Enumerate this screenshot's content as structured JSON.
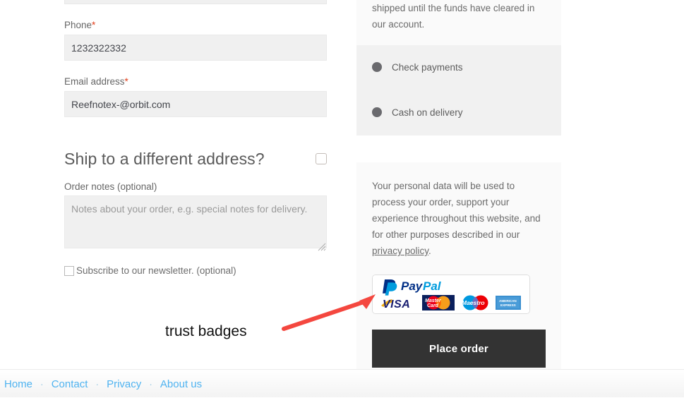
{
  "billing": {
    "phone": {
      "label": "Phone",
      "required_mark": "*",
      "value": "1232322332"
    },
    "email": {
      "label": "Email address",
      "required_mark": "*",
      "value": "Reefnotex-@orbit.com"
    }
  },
  "shipping": {
    "title": "Ship to a different address?",
    "notes_label": "Order notes (optional)",
    "notes_value": "",
    "notes_placeholder": "Notes about your order, e.g. special notes for delivery.",
    "newsletter_label": "Subscribe to our newsletter. (optional)"
  },
  "order_review": {
    "bank_note": "shipped until the funds have cleared in our account.",
    "payment_methods": [
      {
        "label": "Check payments"
      },
      {
        "label": "Cash on delivery"
      }
    ],
    "privacy_text_before": "Your personal data will be used to process your order, support your experience throughout this website, and for other purposes described in our ",
    "privacy_link": "privacy policy",
    "privacy_text_after": ".",
    "badge": {
      "paypal_pay": "Pay",
      "paypal_pal": "Pal",
      "visa": "VISA",
      "mastercard_top": "Master",
      "mastercard_bottom": "Card",
      "maestro": "Maestro",
      "amex_top": "AMERICAN",
      "amex_bottom": "EXPRESS"
    },
    "place_order_label": "Place order"
  },
  "annotation": {
    "label": "trust badges",
    "arrow_color": "#f4473f"
  },
  "footer": {
    "separator": "·",
    "links": [
      {
        "label": "Home"
      },
      {
        "label": "Contact"
      },
      {
        "label": "Privacy"
      },
      {
        "label": "About us"
      }
    ]
  },
  "colors": {
    "accent_link": "#4fb3f0",
    "required": "#e2401c",
    "button_bg": "#333333",
    "panel_light": "#fafafa",
    "panel_gray": "#f1f1f1"
  }
}
